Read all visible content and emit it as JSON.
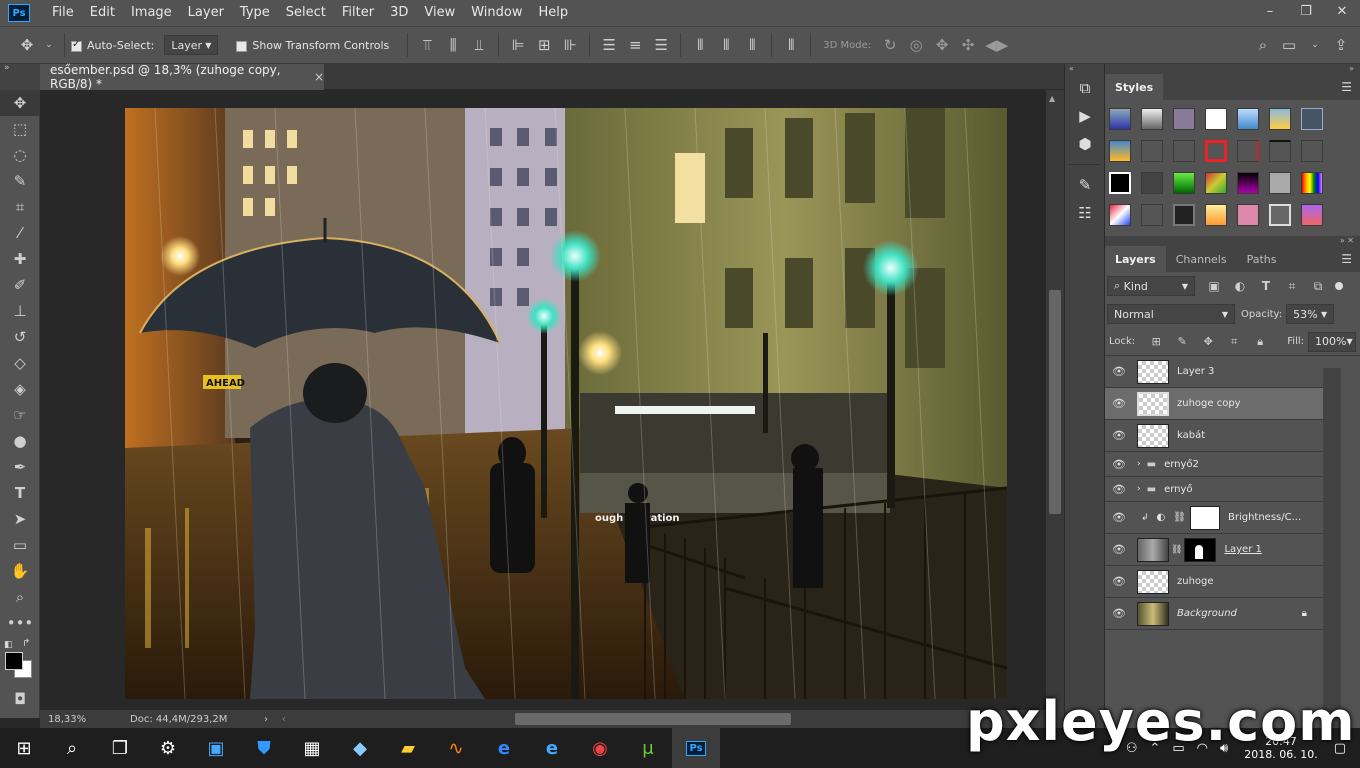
{
  "menubar": {
    "app_icon": "Ps",
    "items": [
      "File",
      "Edit",
      "Image",
      "Layer",
      "Type",
      "Select",
      "Filter",
      "3D",
      "View",
      "Window",
      "Help"
    ],
    "window_controls": [
      "–",
      "❐",
      "✕"
    ]
  },
  "options": {
    "auto_select_label": "Auto-Select:",
    "auto_select_checked": true,
    "auto_select_value": "Layer",
    "transform_label": "Show Transform Controls",
    "mode_3d_label": "3D Mode:"
  },
  "document": {
    "tab_title": "esőember.psd @ 18,3% (zuhoge copy, RGB/8) *",
    "tab_close": "×"
  },
  "status": {
    "zoom": "18,33%",
    "doc_info": "Doc: 44,4M/293,2M"
  },
  "styles_panel": {
    "title": "Styles"
  },
  "layers_panel": {
    "tabs": [
      "Layers",
      "Channels",
      "Paths"
    ],
    "filter_kind": "Kind",
    "blend_mode": "Normal",
    "opacity_label": "Opacity:",
    "opacity_value": "53%",
    "lock_label": "Lock:",
    "fill_label": "Fill:",
    "fill_value": "100%",
    "layers": [
      {
        "name": "Layer 3"
      },
      {
        "name": "zuhoge copy"
      },
      {
        "name": "kabát"
      },
      {
        "name": "ernyő2"
      },
      {
        "name": "ernyő"
      },
      {
        "name": "Brightness/C..."
      },
      {
        "name": "Layer 1"
      },
      {
        "name": "zuhoge"
      },
      {
        "name": "Background"
      }
    ]
  },
  "canvas": {
    "sign_text": "AHEAD",
    "station_text": "ough H   Station"
  },
  "taskbar": {
    "time": "20:47",
    "date": "2018. 06. 10."
  },
  "watermark": "pxleyes.com"
}
